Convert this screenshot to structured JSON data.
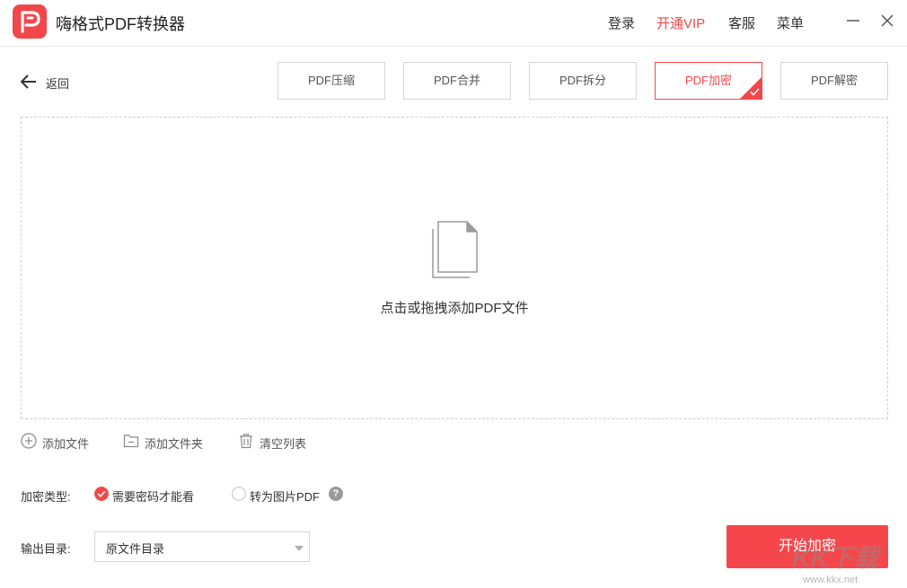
{
  "app": {
    "title": "嗨格式PDF转换器"
  },
  "menu": {
    "login": "登录",
    "vip": "开通VIP",
    "service": "客服",
    "menu": "菜单"
  },
  "nav": {
    "back": "返回"
  },
  "tabs": [
    {
      "label": "PDF压缩",
      "active": false
    },
    {
      "label": "PDF合并",
      "active": false
    },
    {
      "label": "PDF拆分",
      "active": false
    },
    {
      "label": "PDF加密",
      "active": true
    },
    {
      "label": "PDF解密",
      "active": false
    }
  ],
  "dropzone": {
    "text": "点击或拖拽添加PDF文件"
  },
  "actions": {
    "add_file": "添加文件",
    "add_folder": "添加文件夹",
    "clear_list": "清空列表"
  },
  "encrypt": {
    "label": "加密类型:",
    "options": [
      {
        "label": "需要密码才能看",
        "selected": true
      },
      {
        "label": "转为图片PDF",
        "selected": false
      }
    ],
    "help": "?"
  },
  "output": {
    "label": "输出目录:",
    "selected": "原文件目录"
  },
  "start_button": "开始加密",
  "watermark": {
    "big": "KK下载",
    "small": "www.kkx.net"
  },
  "colors": {
    "accent": "#f2474a",
    "button": "#f5474b",
    "border": "#d6d6d6"
  },
  "icons": {
    "logo": "pdf-logo-icon",
    "minimize": "minimize-icon",
    "close": "close-icon",
    "back": "arrow-left-icon",
    "files": "documents-icon",
    "add_file": "plus-circle-icon",
    "add_folder": "folder-icon",
    "clear": "trash-icon",
    "help": "question-icon"
  }
}
